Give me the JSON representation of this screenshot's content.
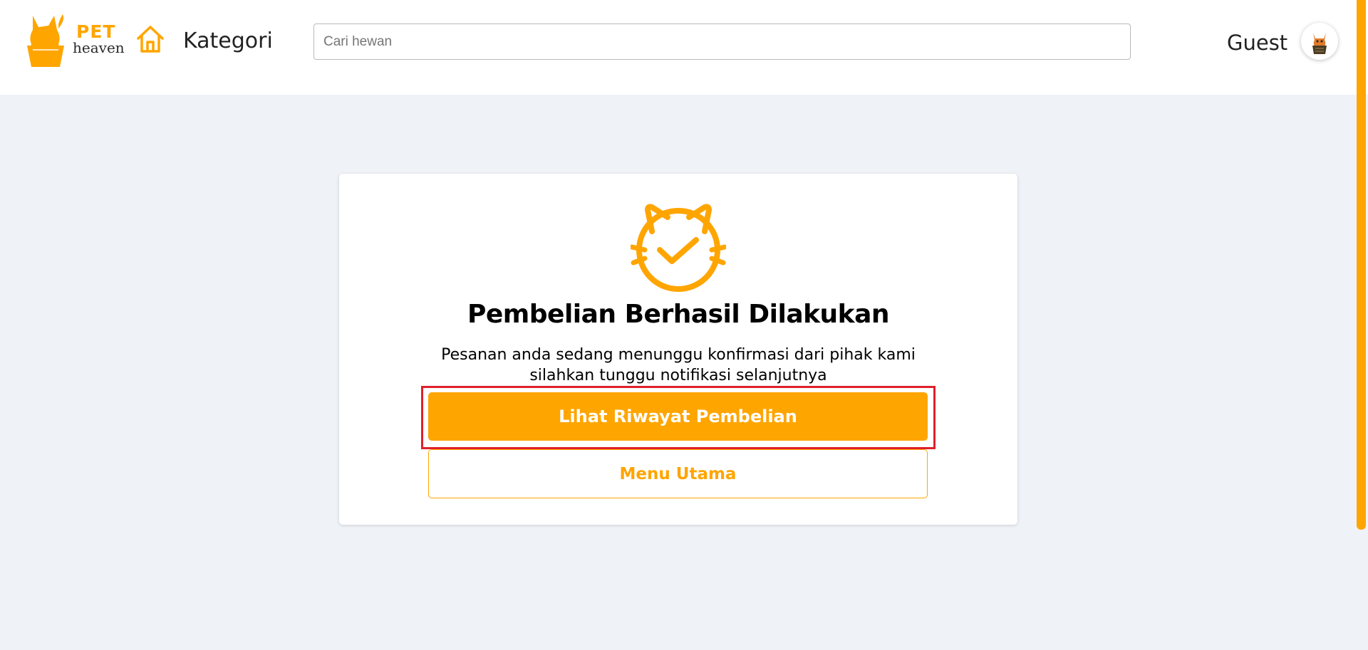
{
  "header": {
    "logo": {
      "brand_top": "PET",
      "brand_bottom": "heaven"
    },
    "home_icon": "home-icon",
    "category_label": "Kategori",
    "search": {
      "placeholder": "Cari hewan",
      "value": ""
    },
    "user_label": "Guest",
    "avatar_icon": "avatar-icon"
  },
  "card": {
    "icon": "cat-check-icon",
    "title": "Pembelian Berhasil Dilakukan",
    "message_line1": "Pesanan anda sedang menunggu konfirmasi dari pihak kami",
    "message_line2": "silahkan tunggu notifikasi selanjutnya",
    "primary_button": "Lihat Riwayat Pembelian",
    "secondary_button": "Menu Utama"
  },
  "colors": {
    "accent": "#ffa500",
    "background": "#eff2f7",
    "highlight": "#e0202a"
  }
}
